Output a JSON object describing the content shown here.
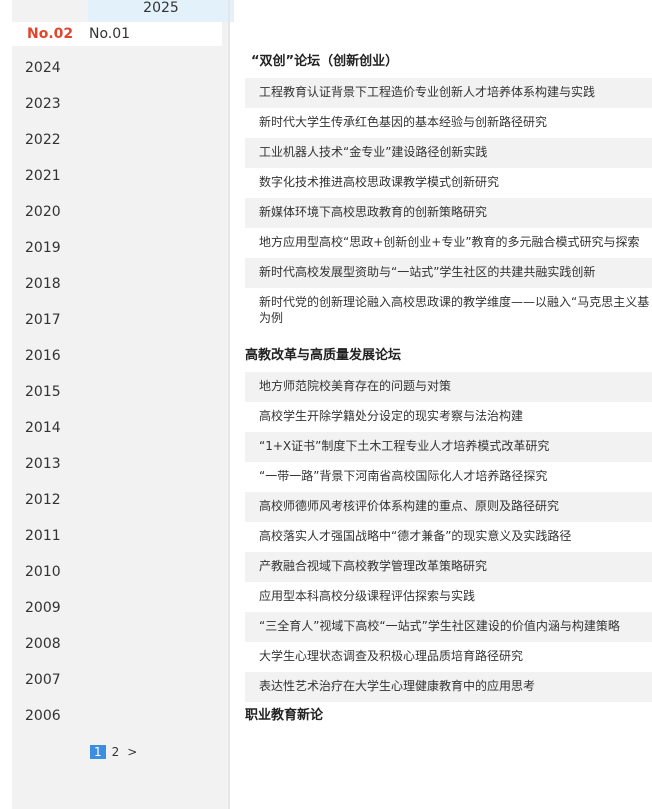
{
  "sidebar": {
    "current_year": "2025",
    "issues": {
      "active": "No.02",
      "other": "No.01"
    },
    "years": [
      "2024",
      "2023",
      "2022",
      "2021",
      "2020",
      "2019",
      "2018",
      "2017",
      "2016",
      "2015",
      "2014",
      "2013",
      "2012",
      "2011",
      "2010",
      "2009",
      "2008",
      "2007",
      "2006"
    ],
    "pager": {
      "current": "1",
      "page2": "2",
      "next": ">"
    }
  },
  "sections": [
    {
      "title": "“双创”论坛（创新创业）",
      "items": [
        "工程教育认证背景下工程造价专业创新人才培养体系构建与实践",
        "新时代大学生传承红色基因的基本经验与创新路径研究",
        "工业机器人技术“金专业”建设路径创新实践",
        "数字化技术推进高校思政课教学模式创新研究",
        "新媒体环境下高校思政教育的创新策略研究",
        "地方应用型高校“思政+创新创业+专业”教育的多元融合模式研究与探索",
        "新时代高校发展型资助与“一站式”学生社区的共建共融实践创新"
      ],
      "wrap_item": {
        "line1": "新时代党的创新理论融入高校思政课的教学维度——以融入“马克思主义基",
        "line2": "为例"
      }
    },
    {
      "title": "高教改革与高质量发展论坛",
      "items": [
        "地方师范院校美育存在的问题与对策",
        "高校学生开除学籍处分设定的现实考察与法治构建",
        "“1+X证书”制度下土木工程专业人才培养模式改革研究",
        "“一带一路”背景下河南省高校国际化人才培养路径探究",
        "高校师德师风考核评价体系构建的重点、原则及路径研究",
        "高校落实人才强国战略中“德才兼备”的现实意义及实践路径",
        "产教融合视域下高校教学管理改革策略研究",
        "应用型本科高校分级课程评估探索与实践",
        "“三全育人”视域下高校“一站式”学生社区建设的价值内涵与构建策略",
        "大学生心理状态调查及积极心理品质培育路径研究",
        "表达性艺术治疗在大学生心理健康教育中的应用思考"
      ]
    },
    {
      "title": "职业教育新论"
    }
  ]
}
